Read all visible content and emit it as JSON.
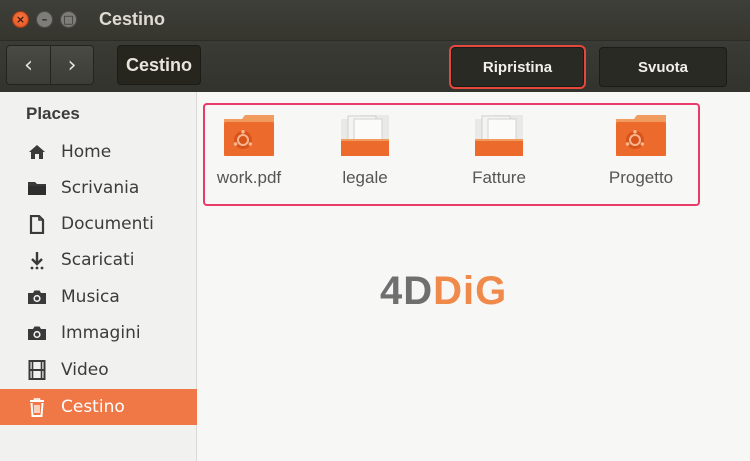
{
  "window": {
    "title": "Cestino"
  },
  "toolbar": {
    "back_glyph": "‹",
    "forward_glyph": "›",
    "path_label": "Cestino",
    "restore_label": "Ripristina",
    "empty_label": "Svuota"
  },
  "sidebar": {
    "heading": "Places",
    "items": [
      {
        "label": "Home",
        "icon": "home-icon"
      },
      {
        "label": "Scrivania",
        "icon": "folder-icon"
      },
      {
        "label": "Documenti",
        "icon": "document-icon"
      },
      {
        "label": "Scaricati",
        "icon": "download-icon"
      },
      {
        "label": "Musica",
        "icon": "camera-icon"
      },
      {
        "label": "Immagini",
        "icon": "camera-icon"
      },
      {
        "label": "Video",
        "icon": "film-icon"
      },
      {
        "label": "Cestino",
        "icon": "trash-icon",
        "active": true
      }
    ]
  },
  "files": [
    {
      "name": "work.pdf",
      "icon": "orange-folder-icon"
    },
    {
      "name": "legale",
      "icon": "document-folder-icon"
    },
    {
      "name": "Fatture",
      "icon": "document-folder-icon"
    },
    {
      "name": "Progetto",
      "icon": "orange-folder-icon"
    }
  ],
  "watermark": {
    "part1": "4D",
    "part2": "DiG"
  },
  "colors": {
    "accent": "#f07746",
    "highlight": "#ea3a6a",
    "restore_outline": "#e5473d"
  }
}
